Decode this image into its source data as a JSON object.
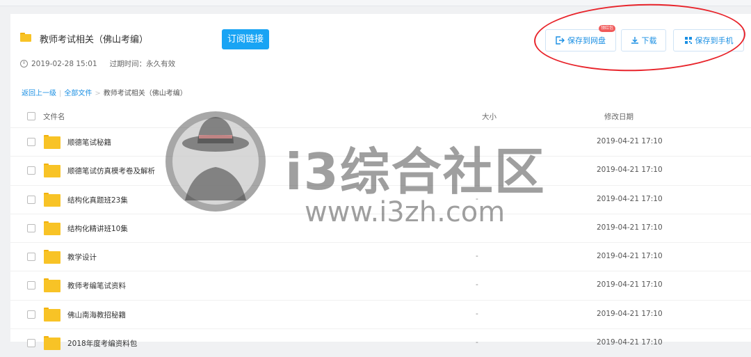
{
  "header": {
    "title": "教师考试相关（佛山考编）",
    "subscribe_label": "订阅链接",
    "created_time": "2019-02-28 15:01",
    "expire_label": "过期时间：永久有效"
  },
  "actions": {
    "save_to_disk": "保存到网盘",
    "badge": "领红包",
    "download": "下载",
    "save_to_phone": "保存到手机"
  },
  "breadcrumb": {
    "back": "返回上一级",
    "all_files": "全部文件",
    "current": "教师考试相关（佛山考编）"
  },
  "table": {
    "columns": {
      "name": "文件名",
      "size": "大小",
      "modified": "修改日期"
    },
    "rows": [
      {
        "name": "顺德笔试秘籍",
        "size": "-",
        "date": "2019-04-21 17:10"
      },
      {
        "name": "顺德笔试仿真模考卷及解析",
        "size": "-",
        "date": "2019-04-21 17:10"
      },
      {
        "name": "结构化真题班23集",
        "size": "-",
        "date": "2019-04-21 17:10"
      },
      {
        "name": "结构化精讲班10集",
        "size": "-",
        "date": "2019-04-21 17:10"
      },
      {
        "name": "教学设计",
        "size": "-",
        "date": "2019-04-21 17:10"
      },
      {
        "name": "教师考编笔试资料",
        "size": "-",
        "date": "2019-04-21 17:10"
      },
      {
        "name": "佛山南海教招秘籍",
        "size": "-",
        "date": "2019-04-21 17:10"
      },
      {
        "name": "2018年度考编资料包",
        "size": "-",
        "date": "2019-04-21 17:10"
      }
    ]
  },
  "watermark": {
    "text": "i3综合社区",
    "url": "www.i3zh.com"
  },
  "colors": {
    "accent": "#19a4f4",
    "annotation": "#e8242b",
    "folder": "#f8c326"
  }
}
